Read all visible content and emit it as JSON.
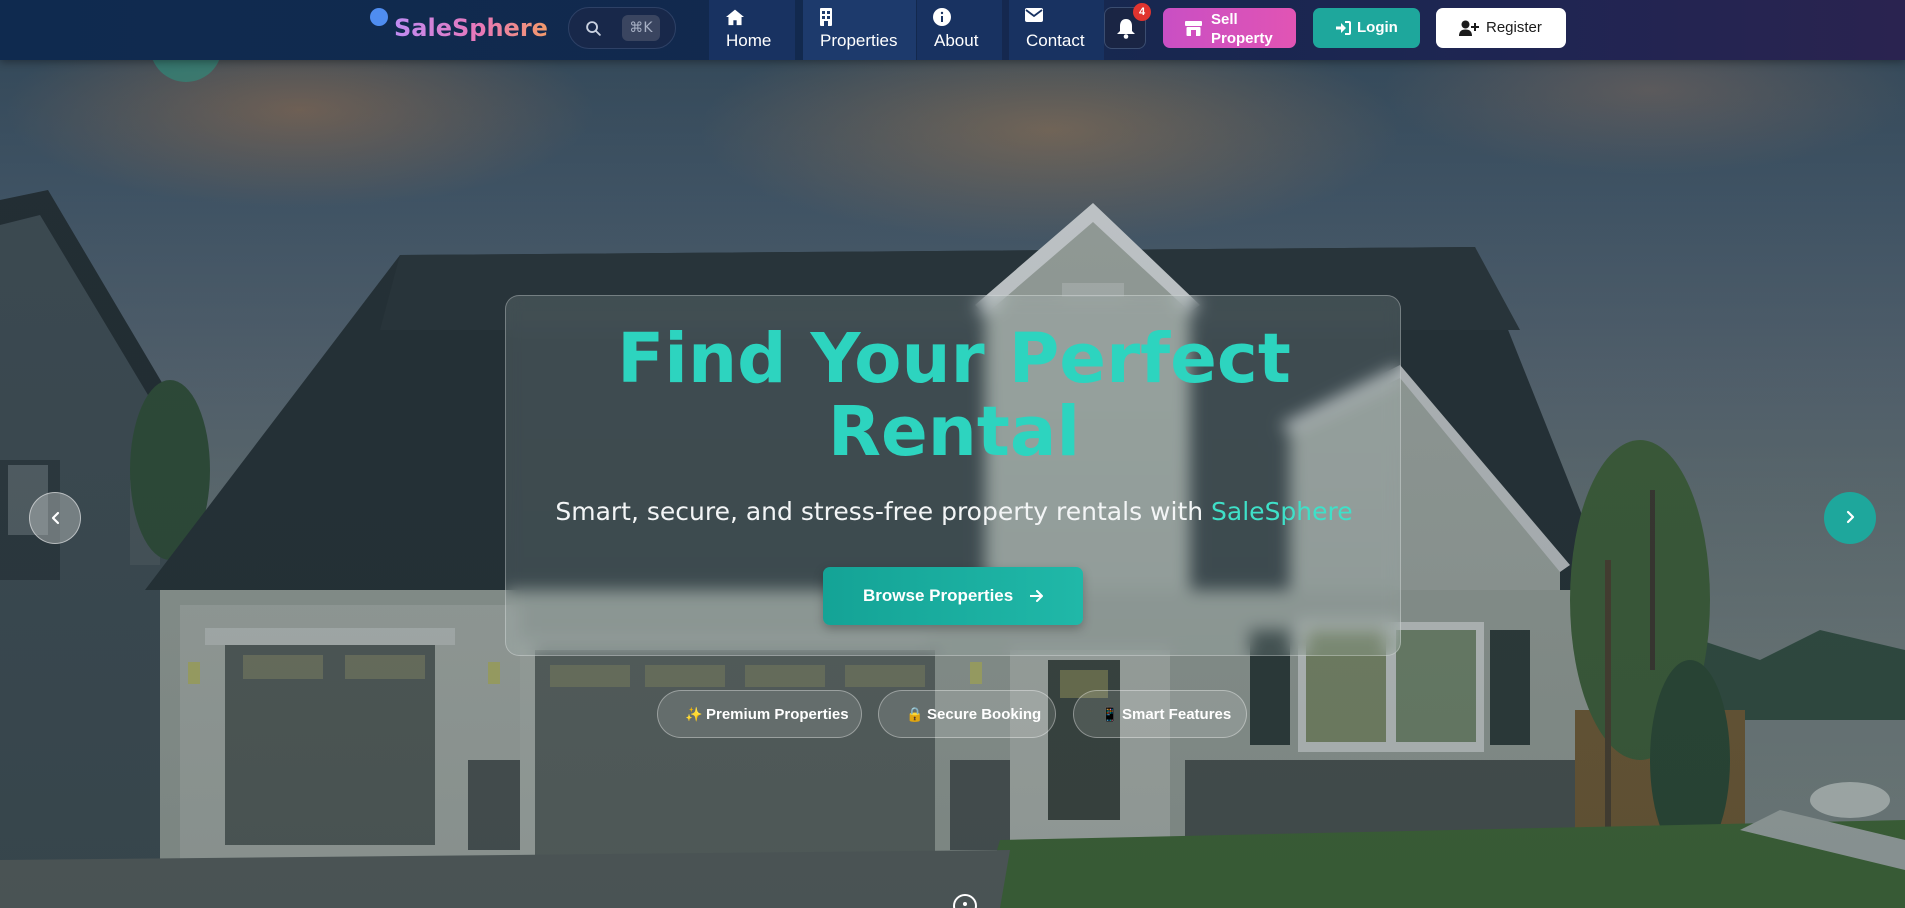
{
  "brand": {
    "name": "SaleSphere"
  },
  "search": {
    "shortcut": "⌘K"
  },
  "nav": {
    "items": [
      {
        "label": "Home",
        "icon": "home-icon"
      },
      {
        "label": "Properties",
        "icon": "building-icon"
      },
      {
        "label": "About",
        "icon": "info-icon"
      },
      {
        "label": "Contact",
        "icon": "envelope-icon"
      }
    ],
    "notifications": {
      "count": "4",
      "icon": "bell-icon"
    },
    "sell_label": "Sell Property",
    "login_label": "Login",
    "register_label": "Register"
  },
  "hero": {
    "title": "Find Your Perfect Rental",
    "subtitle_prefix": "Smart, secure, and stress-free property rentals with ",
    "subtitle_brand": "SaleSphere",
    "cta_label": "Browse Properties"
  },
  "features": [
    {
      "emoji": "✨",
      "label": "Premium Properties"
    },
    {
      "emoji": "🔒",
      "label": "Secure Booking"
    },
    {
      "emoji": "📱",
      "label": "Smart Features"
    }
  ],
  "colors": {
    "accent": "#2dd4bf",
    "login": "#1ea79c",
    "sell": "#d14fbf",
    "badge": "#e0342f"
  }
}
